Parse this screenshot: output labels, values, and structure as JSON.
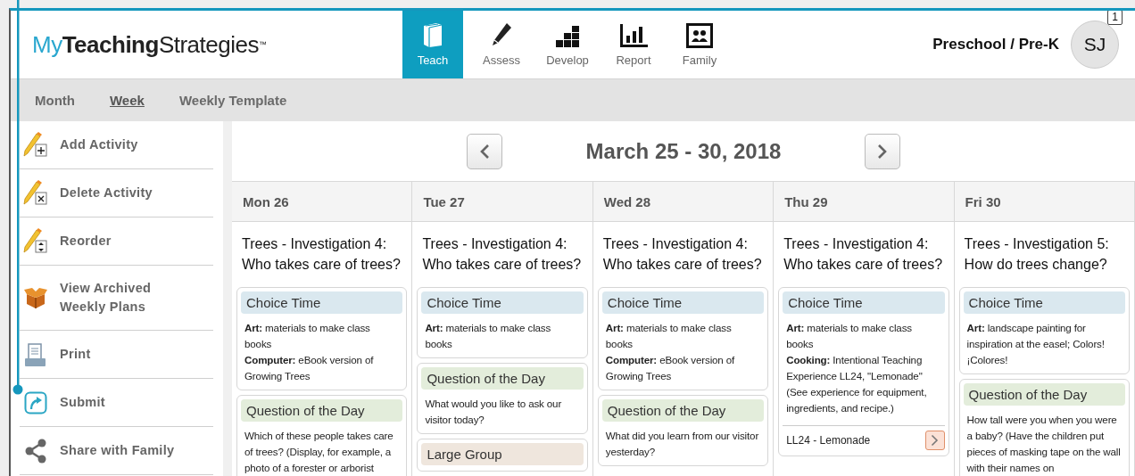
{
  "header": {
    "logo": {
      "prefix": "My",
      "bold": "Teaching",
      "suffix": "Strategies",
      "mark": "™"
    },
    "nav": [
      {
        "label": "Teach",
        "kind": "book",
        "selected": true
      },
      {
        "label": "Assess",
        "kind": "pencil",
        "selected": false
      },
      {
        "label": "Develop",
        "kind": "blocks",
        "selected": false
      },
      {
        "label": "Report",
        "kind": "bars",
        "selected": false
      },
      {
        "label": "Family",
        "kind": "family",
        "selected": false
      }
    ],
    "program": "Preschool / Pre-K",
    "avatar": {
      "initials": "SJ",
      "badge": "1"
    }
  },
  "subnav": [
    {
      "label": "Month",
      "selected": false
    },
    {
      "label": "Week",
      "selected": true
    },
    {
      "label": "Weekly Template",
      "selected": false
    }
  ],
  "sidebar": {
    "items": [
      {
        "label": "Add Activity",
        "kind": "add"
      },
      {
        "label": "Delete Activity",
        "kind": "delete"
      },
      {
        "label": "Reorder",
        "kind": "reorder"
      },
      {
        "label": "View Archived Weekly Plans",
        "kind": "archive"
      },
      {
        "label": "Print",
        "kind": "print"
      },
      {
        "label": "Submit",
        "kind": "submit"
      },
      {
        "label": "Share with Family",
        "kind": "share"
      }
    ]
  },
  "week": {
    "title": "March 25 - 30, 2018",
    "days": [
      {
        "label": "Mon 26",
        "topic": "Trees - Investigation 4: Who takes care of trees?",
        "cards": [
          {
            "kind": "choice",
            "title": "Choice Time",
            "lines": [
              "**Art:** materials to make class books",
              "**Computer:** eBook version of Growing Trees"
            ]
          },
          {
            "kind": "question",
            "title": "Question of the Day",
            "lines": [
              "Which of these people takes care of trees? (Display, for example, a photo of a forester or arborist"
            ]
          }
        ]
      },
      {
        "label": "Tue 27",
        "topic": "Trees - Investigation 4: Who takes care of trees?",
        "cards": [
          {
            "kind": "choice",
            "title": "Choice Time",
            "lines": [
              "**Art:** materials to make class books"
            ]
          },
          {
            "kind": "question",
            "title": "Question of the Day",
            "lines": [
              "What would you like to ask our visitor today?"
            ]
          },
          {
            "kind": "group",
            "title": "Large Group"
          }
        ]
      },
      {
        "label": "Wed 28",
        "topic": "Trees - Investigation 4: Who takes care of trees?",
        "cards": [
          {
            "kind": "choice",
            "title": "Choice Time",
            "lines": [
              "**Art:** materials to make class books",
              "**Computer:** eBook version of Growing Trees"
            ]
          },
          {
            "kind": "question",
            "title": "Question of the Day",
            "lines": [
              "What did you learn from our visitor yesterday?"
            ]
          }
        ]
      },
      {
        "label": "Thu 29",
        "topic": "Trees - Investigation 4: Who takes care of trees?",
        "cards": [
          {
            "kind": "choice",
            "title": "Choice Time",
            "lines": [
              "**Art:** materials to make class books",
              "**Cooking:** Intentional Teaching Experience LL24, \"Lemonade\" (See experience for equipment, ingredients, and recipe.)"
            ],
            "link": "LL24 - Lemonade"
          }
        ]
      },
      {
        "label": "Fri 30",
        "topic": "Trees - Investigation 5: How do trees change?",
        "cards": [
          {
            "kind": "choice",
            "title": "Choice Time",
            "lines": [
              "**Art:** landscape painting for inspiration at the easel; Colors! ¡Colores!"
            ]
          },
          {
            "kind": "question",
            "title": "Question of the Day",
            "lines": [
              "How tall were you when you were a baby? (Have the children put pieces of masking tape on the wall with their names on"
            ]
          }
        ]
      }
    ]
  }
}
